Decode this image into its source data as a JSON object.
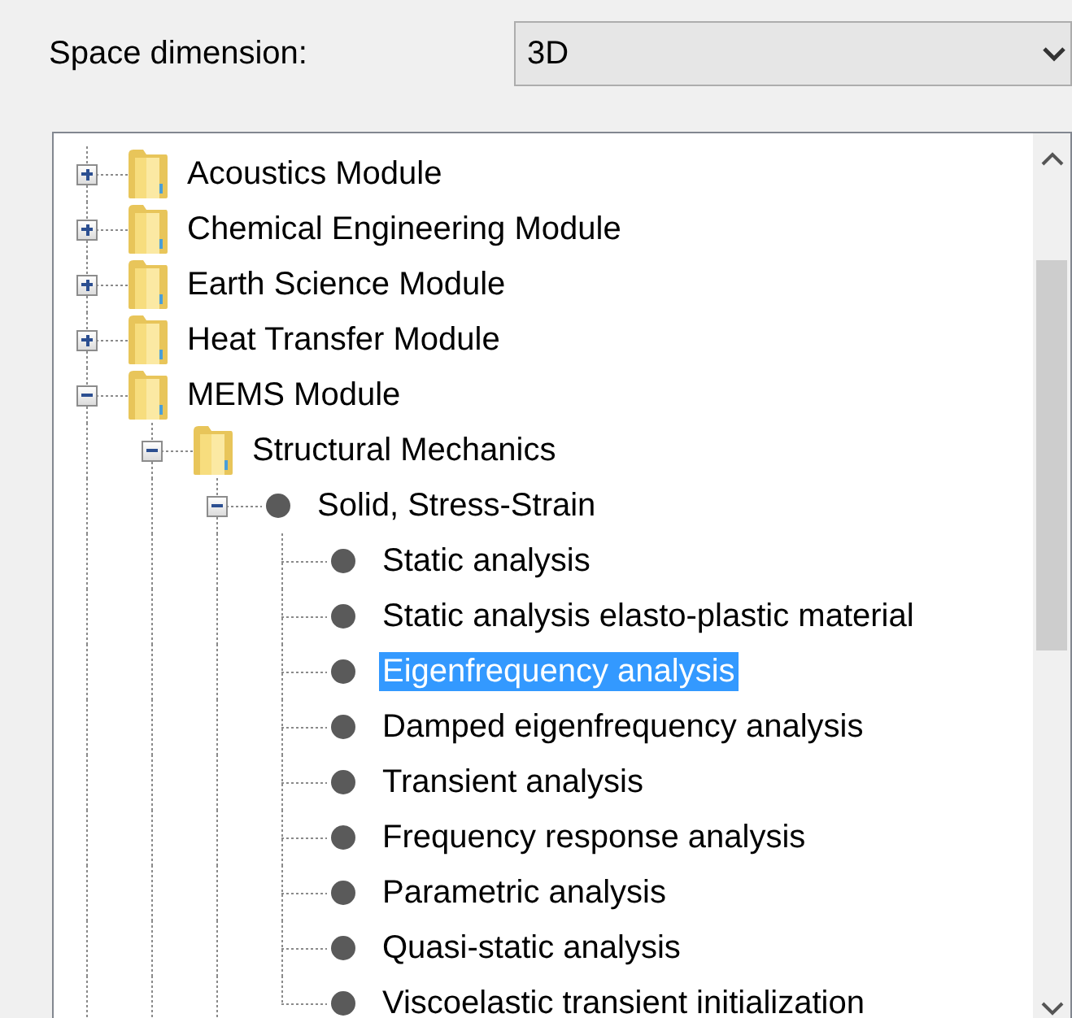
{
  "space_dimension": {
    "label": "Space dimension:",
    "value": "3D"
  },
  "tree": [
    {
      "label": "Acoustics Module",
      "kind": "folder",
      "expanded": false,
      "selected": false
    },
    {
      "label": "Chemical Engineering Module",
      "kind": "folder",
      "expanded": false,
      "selected": false
    },
    {
      "label": "Earth Science Module",
      "kind": "folder",
      "expanded": false,
      "selected": false
    },
    {
      "label": "Heat Transfer Module",
      "kind": "folder",
      "expanded": false,
      "selected": false
    },
    {
      "label": "MEMS Module",
      "kind": "folder",
      "expanded": true,
      "selected": false,
      "children": [
        {
          "label": "Structural Mechanics",
          "kind": "folder",
          "expanded": true,
          "selected": false,
          "children": [
            {
              "label": "Solid, Stress-Strain",
              "kind": "node",
              "expanded": true,
              "selected": false,
              "children": [
                {
                  "label": "Static analysis",
                  "kind": "node",
                  "selected": false
                },
                {
                  "label": "Static analysis elasto-plastic material",
                  "kind": "node",
                  "selected": false
                },
                {
                  "label": "Eigenfrequency analysis",
                  "kind": "node",
                  "selected": true
                },
                {
                  "label": "Damped eigenfrequency analysis",
                  "kind": "node",
                  "selected": false
                },
                {
                  "label": "Transient analysis",
                  "kind": "node",
                  "selected": false
                },
                {
                  "label": "Frequency response analysis",
                  "kind": "node",
                  "selected": false
                },
                {
                  "label": "Parametric analysis",
                  "kind": "node",
                  "selected": false
                },
                {
                  "label": "Quasi-static analysis",
                  "kind": "node",
                  "selected": false
                },
                {
                  "label": "Viscoelastic transient initialization",
                  "kind": "node",
                  "selected": false
                }
              ]
            }
          ]
        }
      ]
    }
  ]
}
